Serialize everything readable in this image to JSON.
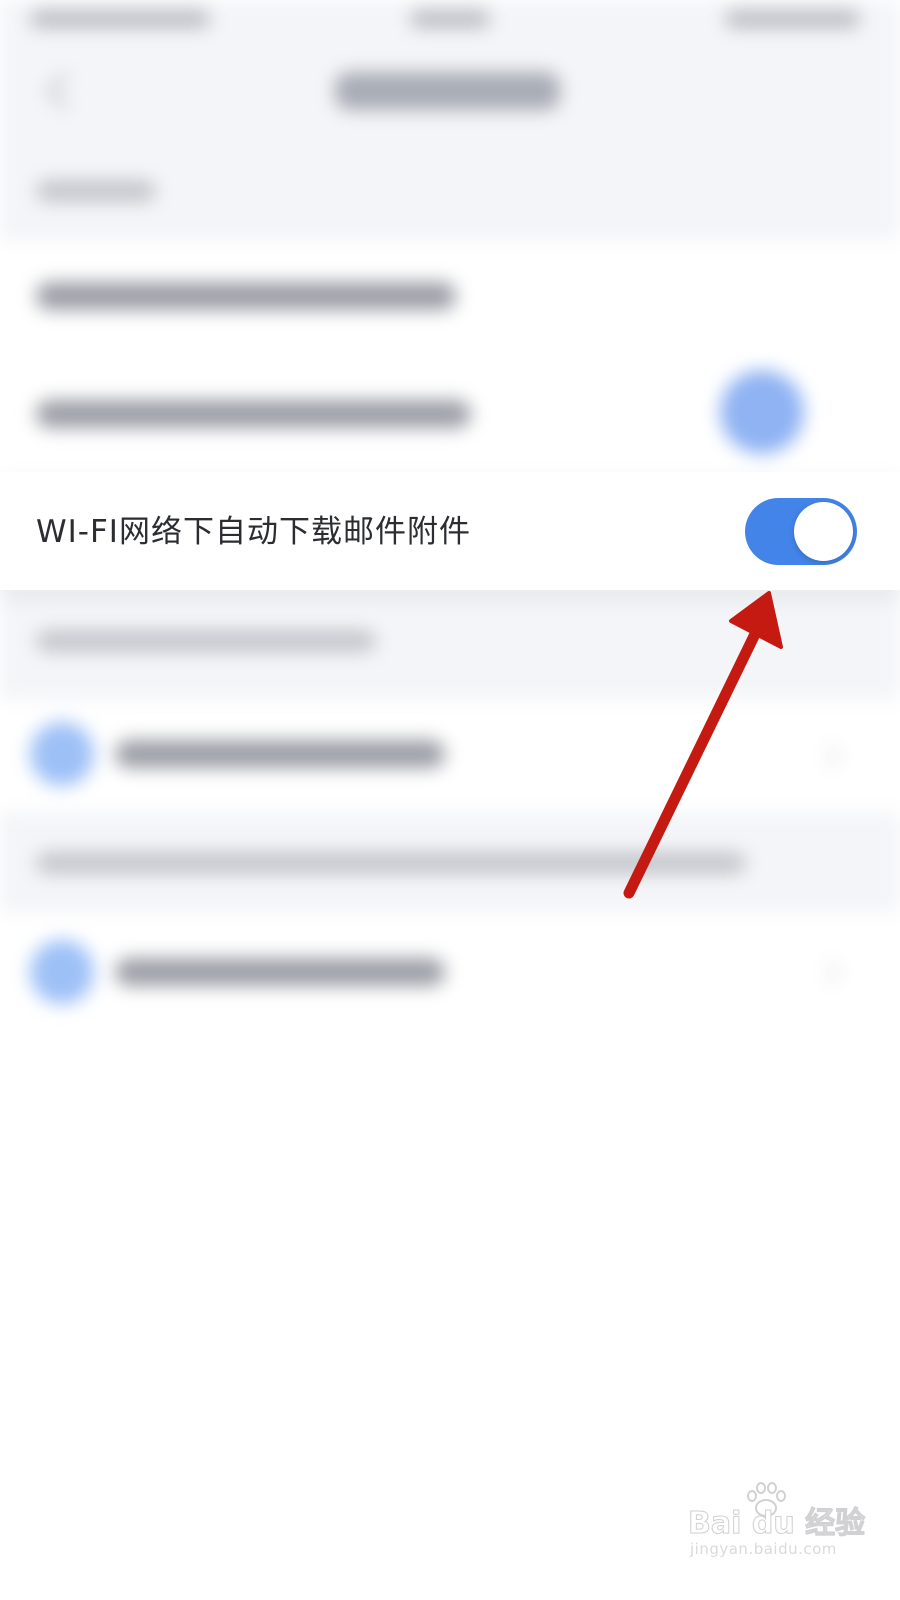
{
  "settings_row": {
    "label": "WI-FI网络下自动下载邮件附件",
    "toggle_on": true
  },
  "colors": {
    "toggle_active": "#4384e8",
    "annotation_arrow": "#c41a12",
    "background": "#ffffff",
    "section_background": "#f4f5f8"
  },
  "icons": {
    "toggle_knob": "toggle-knob",
    "annotation_arrow": "red-arrow-icon",
    "watermark_paw": "paw-icon"
  },
  "watermark": {
    "brand": "Bai du 经验",
    "url": "jingyan.baidu.com"
  }
}
